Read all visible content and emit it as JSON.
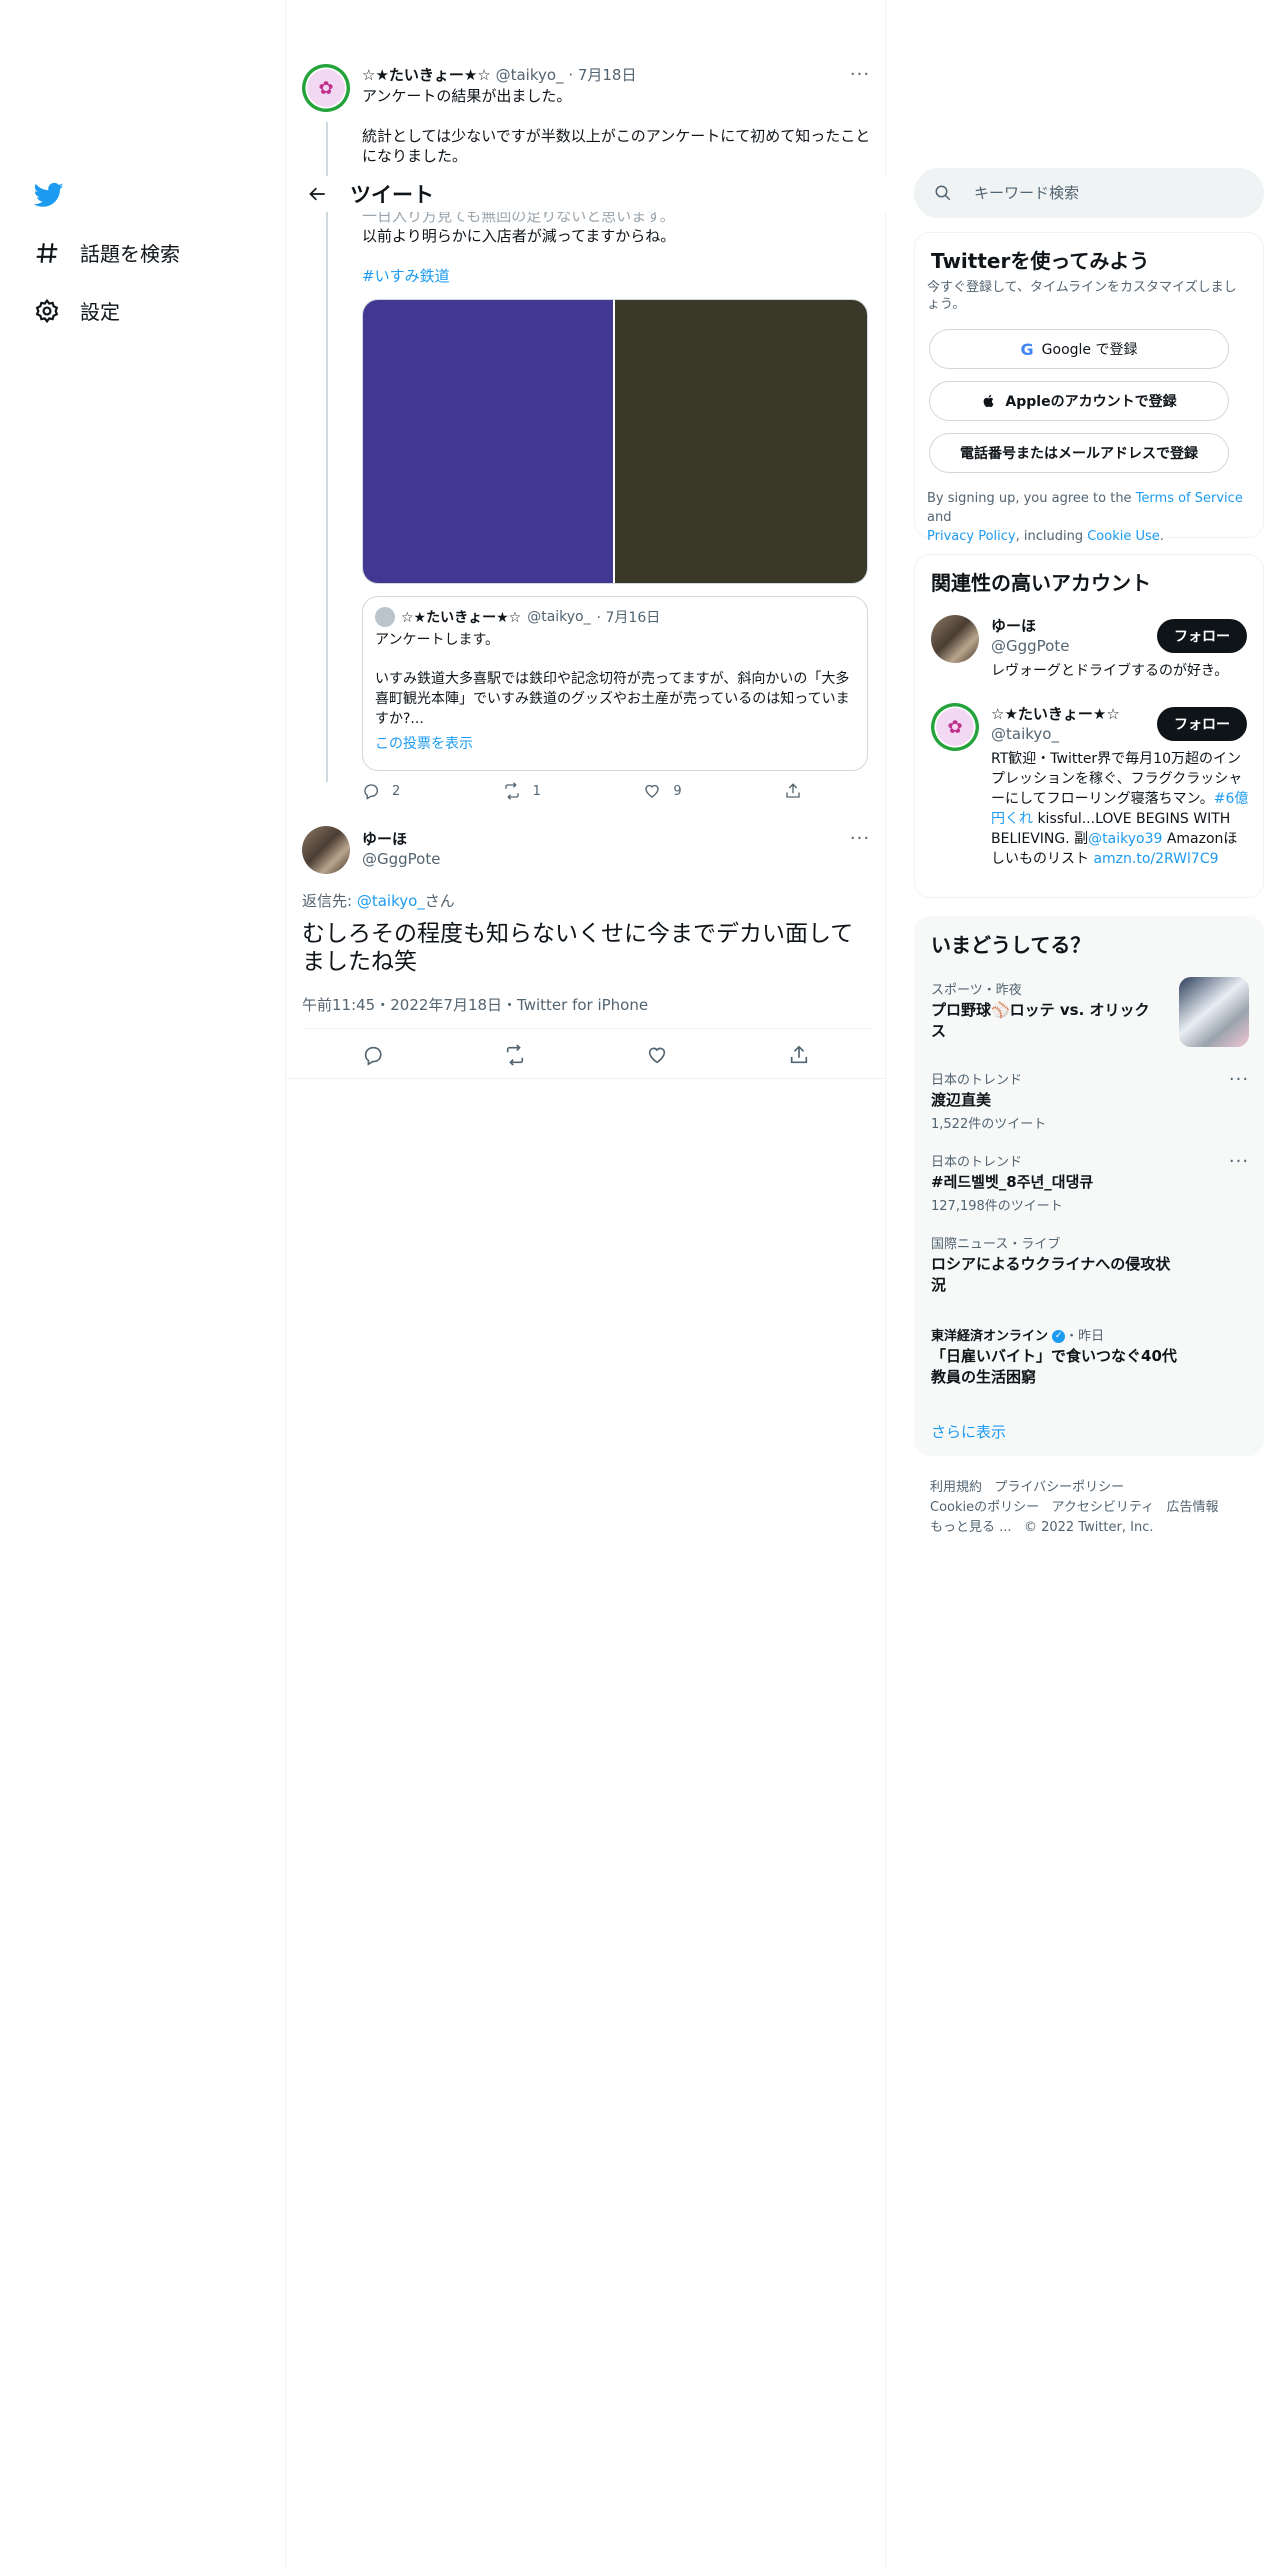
{
  "nav": {
    "explore_label": "話題を検索",
    "settings_label": "設定"
  },
  "header": {
    "title": "ツイート"
  },
  "parent_tweet": {
    "author_name": "☆★たいきょー★☆",
    "author_handle": "@taikyo_",
    "date": "· 7月18日",
    "line1": "アンケートの結果が出ました。",
    "line2": "統計としては少ないですが半数以上がこのアンケートにて初めて知ったことになりました。",
    "line3": "一日入り方見ても無回の足りないと思います。",
    "line4": "以前より明らかに入店者が減ってますからね。",
    "hashtag": "#いすみ鉄道",
    "quote": {
      "author_name": "☆★たいきょー★☆",
      "author_handle": "@taikyo_",
      "date": "· 7月16日",
      "line1": "アンケートします。",
      "line2": "いすみ鉄道大多喜駅では鉄印や記念切符が売ってますが、斜向かいの「大多喜町観光本陣」でいすみ鉄道のグッズやお土産が売っているのは知っていますか?...",
      "show_poll": "この投票を表示"
    },
    "replies": "2",
    "retweets": "1",
    "likes": "9"
  },
  "main_tweet": {
    "author_name": "ゆーほ",
    "author_handle": "@GggPote",
    "reply_to_prefix": "返信先: ",
    "reply_to_handle": "@taikyo_",
    "reply_to_suffix": "さん",
    "text": "むしろその程度も知らないくせに今までデカい面してましたね笑",
    "timestamp": "午前11:45・2022年7月18日・Twitter for iPhone"
  },
  "search": {
    "placeholder": "キーワード検索"
  },
  "signup": {
    "title": "Twitterを使ってみよう",
    "subtitle": "今すぐ登録して、タイムラインをカスタマイズしましょう。",
    "google": "Google で登録",
    "apple": "Appleのアカウントで登録",
    "phone": "電話番号またはメールアドレスで登録",
    "terms_1": "By signing up, you agree to the ",
    "terms_link": "Terms of Service",
    "terms_2": " and",
    "privacy_link": "Privacy Policy",
    "terms_3": ", including ",
    "cookie_link": "Cookie Use",
    "terms_4": "."
  },
  "related": {
    "title": "関連性の高いアカウント",
    "follow_label": "フォロー",
    "accounts": [
      {
        "name": "ゆーほ",
        "handle": "@GggPote",
        "bio": "レヴォーグとドライブするのが好き。"
      },
      {
        "name": "☆★たいきょー★☆",
        "handle": "@taikyo_",
        "bio_1": "RT歓迎・Twitter界で毎月10万超のインプレッションを稼ぐ、フラグクラッシャーにしてフローリング寝落ちマン。",
        "bio_link1": "#6億円くれ",
        "bio_2": " kissful...LOVE BEGINS WITH BELIEVING. 副",
        "bio_link2": "@taikyo39",
        "bio_3": " Amazonほしいものリスト",
        "bio_link3": "amzn.to/2RWl7C9"
      }
    ]
  },
  "trends": {
    "title": "いまどうしてる？",
    "items": [
      {
        "category": "スポーツ・昨夜",
        "name": "プロ野球⚾ロッテ vs. オリックス",
        "count": ""
      },
      {
        "category": "日本のトレンド",
        "name": "渡辺直美",
        "count": "1,522件のツイート"
      },
      {
        "category": "日本のトレンド",
        "name": "#레드벨벳_8주년_대댕큐",
        "count": "127,198件のツイート"
      },
      {
        "category": "国際ニュース・ライブ",
        "name": "ロシアによるウクライナへの侵攻状況",
        "count": ""
      },
      {
        "category": "東洋経済オンライン",
        "category_suffix": "・昨日",
        "name": "「日雇いバイト」で食いつなぐ40代教員の生活困窮",
        "count": ""
      }
    ],
    "show_more": "さらに表示"
  },
  "footer": {
    "line1_a": "利用規約",
    "line1_b": "プライバシーポリシー",
    "line2_a": "Cookieのポリシー",
    "line2_b": "アクセシビリティ",
    "line2_c": "広告情報",
    "line3_a": "もっと見る ...",
    "line3_b": "© 2022 Twitter, Inc."
  },
  "colors": {
    "accent": "#1d9bf0",
    "text": "#0f1419",
    "secondary": "#536471",
    "border": "#eff3f4"
  }
}
